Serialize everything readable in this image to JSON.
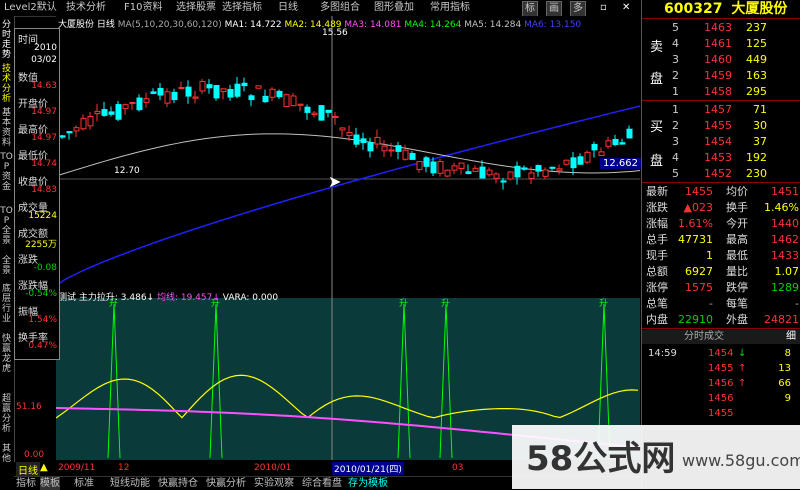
{
  "toolbar": {
    "items": [
      "Level2默认",
      "技术分析",
      "F10资料",
      "选择股票",
      "选择指标",
      "日线",
      "多图组合",
      "图形叠加",
      "常用指标"
    ],
    "right_tabs": [
      "标",
      "画",
      "多"
    ]
  },
  "left_vtabs": [
    "分时走势",
    "技术分析",
    "基本资料",
    "TOP资金",
    "TOP全景",
    "全景",
    "底层行业",
    "快赢龙虎",
    "超赢分析",
    "其他"
  ],
  "price_chart": {
    "title": "大厦股份 日线",
    "ma_params": "MA(5,10,20,30,60,120)",
    "ma_values": [
      {
        "label": "MA1: 14.722",
        "color": "#ffffff"
      },
      {
        "label": "MA2: 14.489",
        "color": "#ffff00"
      },
      {
        "label": "MA3: 14.081",
        "color": "#ff50ff"
      },
      {
        "label": "MA4: 14.264",
        "color": "#00ff00"
      },
      {
        "label": "MA5: 14.284",
        "color": "#c0c0c0"
      },
      {
        "label": "MA6: 13.150",
        "color": "#4040ff"
      }
    ],
    "high_label": "15.56",
    "low_label": "12.70",
    "price_tag": "12.662"
  },
  "indicator": {
    "name": "测试",
    "line1": "主力拉升: 3.486↓",
    "line2": "均线: 19.457↓",
    "line3": "VARA: 0.000",
    "level_51": "51.16",
    "level_0": "0.00",
    "signal_mark": "升"
  },
  "cursor_info": {
    "labels": [
      "时间",
      "数值",
      "开盘价",
      "最高价",
      "最低价",
      "收盘价",
      "成交量",
      "成交额",
      "涨跌",
      "涨跌幅",
      "振幅",
      "换手率"
    ],
    "time_values": [
      "2010",
      "03/02"
    ],
    "values": [
      "14.63",
      "14.97",
      "14.97",
      "14.74",
      "14.83",
      "15224",
      "2255万",
      "-0.08",
      "-0.54%",
      "1.54%",
      "0.47%"
    ]
  },
  "date_axis": {
    "period": "日线",
    "dates": [
      "2009/11",
      "12",
      "2010/01",
      "2010/01/21(四)",
      "03"
    ]
  },
  "bottom_tabs": [
    "指标",
    "模板",
    "标准",
    "短线动能",
    "快赢持仓",
    "快赢分析",
    "实验观察",
    "综合看盘",
    "存为模板"
  ],
  "quote": {
    "code": "600327",
    "name": "大厦股份",
    "sell_label": [
      "卖",
      "盘"
    ],
    "buy_label": [
      "买",
      "盘"
    ],
    "asks": [
      {
        "lvl": "5",
        "price": "1463",
        "vol": "237"
      },
      {
        "lvl": "4",
        "price": "1461",
        "vol": "125"
      },
      {
        "lvl": "3",
        "price": "1460",
        "vol": "449"
      },
      {
        "lvl": "2",
        "price": "1459",
        "vol": "163"
      },
      {
        "lvl": "1",
        "price": "1458",
        "vol": "295"
      }
    ],
    "bids": [
      {
        "lvl": "1",
        "price": "1457",
        "vol": "71"
      },
      {
        "lvl": "2",
        "price": "1455",
        "vol": "30"
      },
      {
        "lvl": "3",
        "price": "1454",
        "vol": "37"
      },
      {
        "lvl": "4",
        "price": "1453",
        "vol": "192"
      },
      {
        "lvl": "5",
        "price": "1452",
        "vol": "230"
      }
    ],
    "stats": [
      {
        "l1": "最新",
        "v1": "1455",
        "c1": "red",
        "l2": "均价",
        "v2": "1451",
        "c2": "red"
      },
      {
        "l1": "涨跌",
        "v1": "▲023",
        "c1": "red",
        "l2": "换手",
        "v2": "1.46%",
        "c2": "yellow"
      },
      {
        "l1": "涨幅",
        "v1": "1.61%",
        "c1": "red",
        "l2": "今开",
        "v2": "1440",
        "c2": "red"
      },
      {
        "l1": "总手",
        "v1": "47731",
        "c1": "yellow",
        "l2": "最高",
        "v2": "1462",
        "c2": "red"
      },
      {
        "l1": "现手",
        "v1": "1",
        "c1": "yellow",
        "l2": "最低",
        "v2": "1433",
        "c2": "red"
      },
      {
        "l1": "总额",
        "v1": "6927",
        "c1": "yellow",
        "l2": "量比",
        "v2": "1.07",
        "c2": "yellow"
      },
      {
        "l1": "涨停",
        "v1": "1575",
        "c1": "red",
        "l2": "跌停",
        "v2": "1289",
        "c2": "green"
      },
      {
        "l1": "总笔",
        "v1": "-",
        "c1": "gray",
        "l2": "每笔",
        "v2": "-",
        "c2": "gray"
      },
      {
        "l1": "内盘",
        "v1": "22910",
        "c1": "green",
        "l2": "外盘",
        "v2": "24821",
        "c2": "red"
      }
    ],
    "ticks_header": "分时成交",
    "ticks_tab": "细",
    "ticks": [
      {
        "time": "14:59",
        "price": "1454",
        "arrow": "↓",
        "vol": "8"
      },
      {
        "time": "",
        "price": "1455",
        "arrow": "↑",
        "vol": "13"
      },
      {
        "time": "",
        "price": "1456",
        "arrow": "↑",
        "vol": "66"
      },
      {
        "time": "",
        "price": "1456",
        "arrow": "",
        "vol": "9"
      },
      {
        "time": "",
        "price": "1455",
        "arrow": "",
        "vol": ""
      }
    ]
  },
  "watermark": {
    "text": "58公式网",
    "url": "www.58gu.com"
  },
  "colors": {
    "up": "#ff3232",
    "down": "#00d200",
    "ma_blue": "#2020ff",
    "indicator_bg": "#0a3a3a"
  }
}
